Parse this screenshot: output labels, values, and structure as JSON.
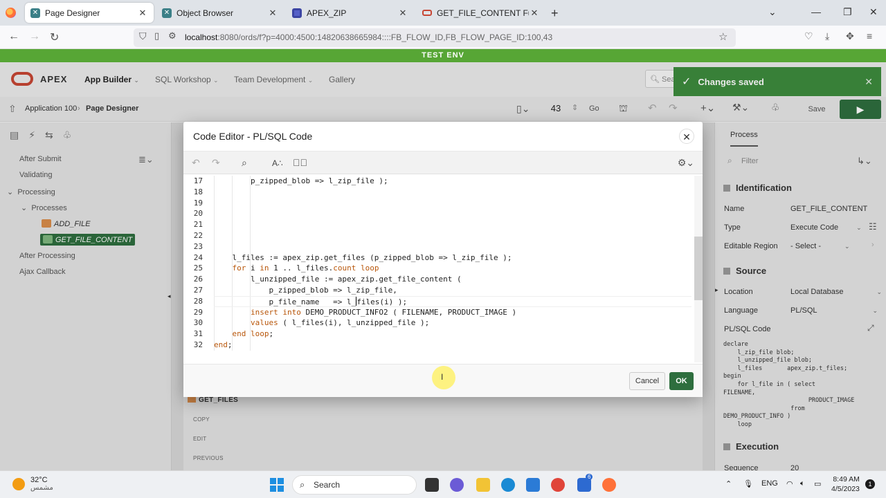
{
  "browser": {
    "tabs": [
      {
        "label": "Page Designer",
        "icon": "apex-icon"
      },
      {
        "label": "Object Browser",
        "icon": "apex-icon"
      },
      {
        "label": "APEX_ZIP",
        "icon": "zip-doc-icon"
      },
      {
        "label": "GET_FILE_CONTENT Function",
        "icon": "oracle-icon"
      }
    ],
    "url_host": "localhost",
    "url_rest": ":8080/ords/f?p=4000:4500:14820638665984::::FB_FLOW_ID,FB_FLOW_PAGE_ID:100,43"
  },
  "env_banner": "TEST ENV",
  "apex": {
    "brand": "APEX",
    "menu": [
      "App Builder",
      "SQL Workshop",
      "Team Development",
      "Gallery"
    ],
    "search_placeholder": "Sear",
    "toast": "Changes saved",
    "breadcrumb": [
      "Application 100",
      "Page Designer"
    ],
    "page_number": "43",
    "go_label": "Go",
    "save_label": "Save"
  },
  "left_tree": {
    "items": [
      "After Submit",
      "Validating",
      "Processing",
      "Processes",
      "ADD_FILE",
      "GET_FILE_CONTENT",
      "After Processing",
      "Ajax Callback"
    ]
  },
  "center": {
    "region_title": "GET_FILES",
    "buttons": [
      "COPY",
      "EDIT",
      "PREVIOUS"
    ]
  },
  "right_pane": {
    "tab": "Process",
    "filter_placeholder": "Filter",
    "identification": "Identification",
    "name_label": "Name",
    "name_value": "GET_FILE_CONTENT",
    "type_label": "Type",
    "type_value": "Execute Code",
    "region_label": "Editable Region",
    "region_value": "- Select -",
    "source": "Source",
    "location_label": "Location",
    "location_value": "Local Database",
    "language_label": "Language",
    "language_value": "PL/SQL",
    "code_label": "PL/SQL Code",
    "code_preview": "declare\n    l_zip_file blob;\n    l_unzipped_file blob;\n    l_files       apex_zip.t_files;\nbegin\n    for l_file in ( select\nFILENAME,\n                        PRODUCT_IMAGE\n                   from\nDEMO_PRODUCT_INFO )\n    loop",
    "execution": "Execution",
    "sequence_label": "Sequence",
    "sequence_value": "20"
  },
  "dialog": {
    "title": "Code Editor - PL/SQL Code",
    "cancel": "Cancel",
    "ok": "OK",
    "lines": [
      {
        "n": "17",
        "parts": [
          [
            "",
            "        p_zipped_blob => l_zip_file );"
          ]
        ]
      },
      {
        "n": "18",
        "parts": [
          [
            "",
            ""
          ]
        ]
      },
      {
        "n": "19",
        "parts": [
          [
            "",
            ""
          ]
        ]
      },
      {
        "n": "20",
        "parts": [
          [
            "",
            ""
          ]
        ]
      },
      {
        "n": "21",
        "parts": [
          [
            "",
            ""
          ]
        ]
      },
      {
        "n": "22",
        "parts": [
          [
            "",
            ""
          ]
        ]
      },
      {
        "n": "23",
        "parts": [
          [
            "",
            ""
          ]
        ]
      },
      {
        "n": "24",
        "parts": [
          [
            "",
            "    l_files := apex_zip.get_files (p_zipped_blob => l_zip_file );"
          ]
        ]
      },
      {
        "n": "25",
        "parts": [
          [
            "",
            "    "
          ],
          [
            "kw",
            "for"
          ],
          [
            "",
            " i "
          ],
          [
            "kw",
            "in"
          ],
          [
            "",
            " 1 .. l_files."
          ],
          [
            "kw",
            "count loop"
          ]
        ]
      },
      {
        "n": "26",
        "parts": [
          [
            "",
            "        l_unzipped_file := apex_zip.get_file_content ("
          ]
        ]
      },
      {
        "n": "27",
        "parts": [
          [
            "",
            "            p_zipped_blob => l_zip_file,"
          ]
        ]
      },
      {
        "n": "28",
        "parts": [
          [
            "",
            "            p_file_name   => l_"
          ],
          [
            "caret",
            ""
          ],
          [
            "",
            "files(i) );"
          ]
        ]
      },
      {
        "n": "29",
        "parts": [
          [
            "",
            "        "
          ],
          [
            "kw",
            "insert into"
          ],
          [
            "",
            " DEMO_PRODUCT_INFO2 ( FILENAME, PRODUCT_IMAGE )"
          ]
        ]
      },
      {
        "n": "30",
        "parts": [
          [
            "",
            "        "
          ],
          [
            "kw",
            "values"
          ],
          [
            "",
            " ( l_files(i), l_unzipped_file );"
          ]
        ]
      },
      {
        "n": "31",
        "parts": [
          [
            "",
            "    "
          ],
          [
            "kw",
            "end loop"
          ],
          [
            "",
            ";"
          ]
        ]
      },
      {
        "n": "32",
        "parts": [
          [
            "kw",
            "end"
          ],
          [
            "",
            ";"
          ]
        ]
      }
    ]
  },
  "taskbar": {
    "temp": "32°C",
    "condition": "مشمس",
    "search": "Search",
    "lang": "ENG",
    "time": "8:49 AM",
    "date": "4/5/2023",
    "notifications": "1",
    "badge": "6"
  },
  "colors": {
    "env": "#57a635",
    "primary": "#2e6e3e",
    "keyword": "#b8560a",
    "oracle_red": "#c74634"
  }
}
